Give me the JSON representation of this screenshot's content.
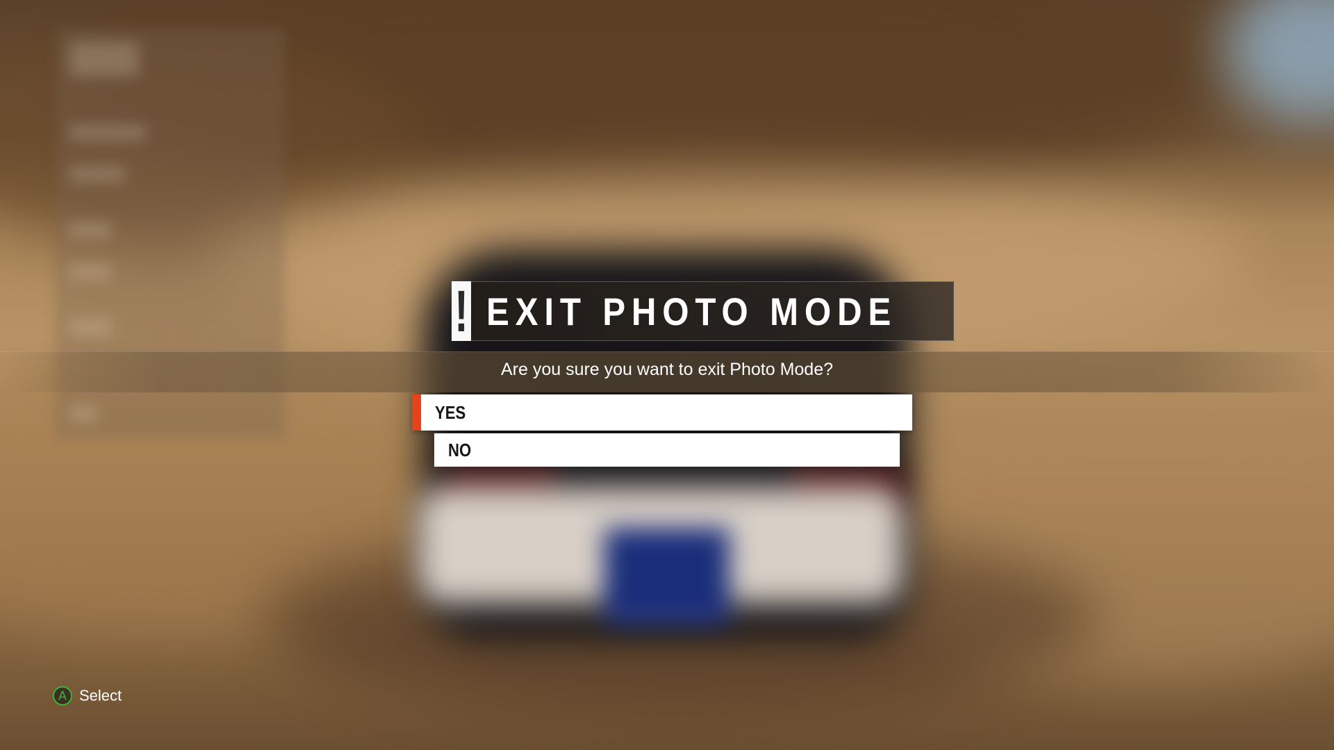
{
  "dialog": {
    "icon": "exclamation-icon",
    "icon_glyph": "!",
    "title": "EXIT PHOTO MODE",
    "question": "Are you sure you want to exit Photo Mode?",
    "options": [
      {
        "label": "YES",
        "selected": true
      },
      {
        "label": "NO",
        "selected": false
      }
    ],
    "accent_color": "#e8421c"
  },
  "footer": {
    "button_glyph": "A",
    "button_icon": "a-button-icon",
    "button_color": "#3ab53a",
    "action_label": "Select"
  }
}
